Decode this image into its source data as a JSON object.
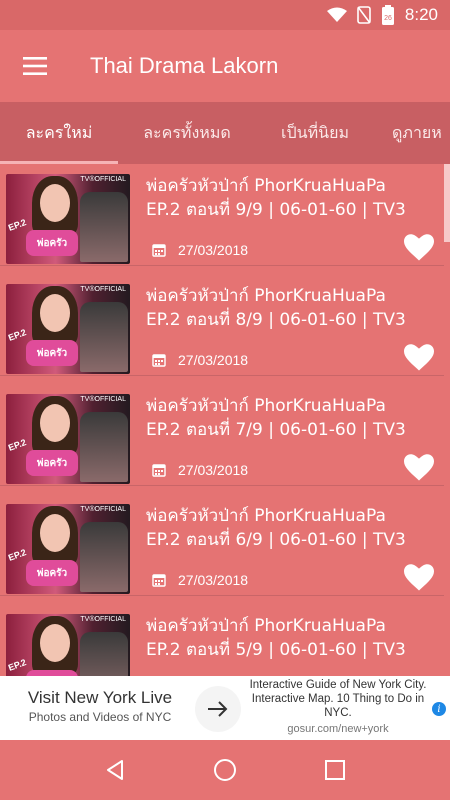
{
  "status_bar": {
    "time": "8:20",
    "icons": [
      "wifi-icon",
      "signal-icon",
      "no-sim-icon",
      "battery-icon"
    ],
    "battery_level": "26"
  },
  "app_bar": {
    "title": "Thai Drama Lakorn",
    "menu_icon": "hamburger-icon"
  },
  "tabs": [
    {
      "label": "ละครใหม่",
      "active": true
    },
    {
      "label": "ละครทั้งหมด",
      "active": false
    },
    {
      "label": "เป็นที่นิยม",
      "active": false
    },
    {
      "label": "ดูภายห",
      "active": false
    }
  ],
  "episodes": [
    {
      "title_line1": "พ่อครัวหัวป่าก์ PhorKruaHuaPa",
      "title_line2": "EP.2 ตอนที่ 9/9 | 06-01-60 | TV3",
      "date": "27/03/2018",
      "favorite": true
    },
    {
      "title_line1": "พ่อครัวหัวป่าก์ PhorKruaHuaPa",
      "title_line2": "EP.2 ตอนที่ 8/9 | 06-01-60 | TV3",
      "date": "27/03/2018",
      "favorite": true
    },
    {
      "title_line1": "พ่อครัวหัวป่าก์ PhorKruaHuaPa",
      "title_line2": "EP.2 ตอนที่ 7/9 | 06-01-60 | TV3",
      "date": "27/03/2018",
      "favorite": true
    },
    {
      "title_line1": "พ่อครัวหัวป่าก์ PhorKruaHuaPa",
      "title_line2": "EP.2 ตอนที่ 6/9 | 06-01-60 | TV3",
      "date": "27/03/2018",
      "favorite": true
    },
    {
      "title_line1": "พ่อครัวหัวป่าก์ PhorKruaHuaPa",
      "title_line2": "EP.2 ตอนที่ 5/9 | 06-01-60 | TV3",
      "date": "",
      "favorite": false
    }
  ],
  "thumbnail": {
    "badge": "TV®OFFICIAL",
    "ep_label": "EP.2",
    "logo_text": "พ่อครัว"
  },
  "ad": {
    "headline": "Visit New York Live",
    "subline": "Photos and Videos of NYC",
    "right_text": "Interactive Guide of New York City. Interactive Map. 10 Thing to Do in NYC.",
    "url": "gosur.com/new+york",
    "info_label": "i"
  },
  "nav_bar": {
    "buttons": [
      "back-icon",
      "home-icon",
      "recents-icon"
    ]
  },
  "colors": {
    "primary": "#e57373",
    "tabs_bg": "#c85f63",
    "status_bg": "#d96868"
  }
}
